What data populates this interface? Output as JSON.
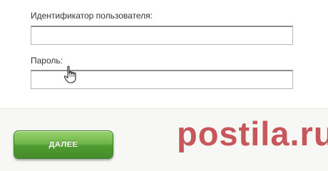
{
  "form": {
    "user_id_label": "Идентификатор пользователя:",
    "user_id_value": "",
    "password_label": "Пароль:",
    "password_value": ""
  },
  "footer": {
    "continue_button_label": "ДАЛЕЕ"
  },
  "watermark": {
    "text": "postila.ru"
  },
  "colors": {
    "button_green": "#5aa83a",
    "watermark_red": "#c44a4f"
  },
  "icons": {
    "cursor": "hand-pointer-icon"
  }
}
